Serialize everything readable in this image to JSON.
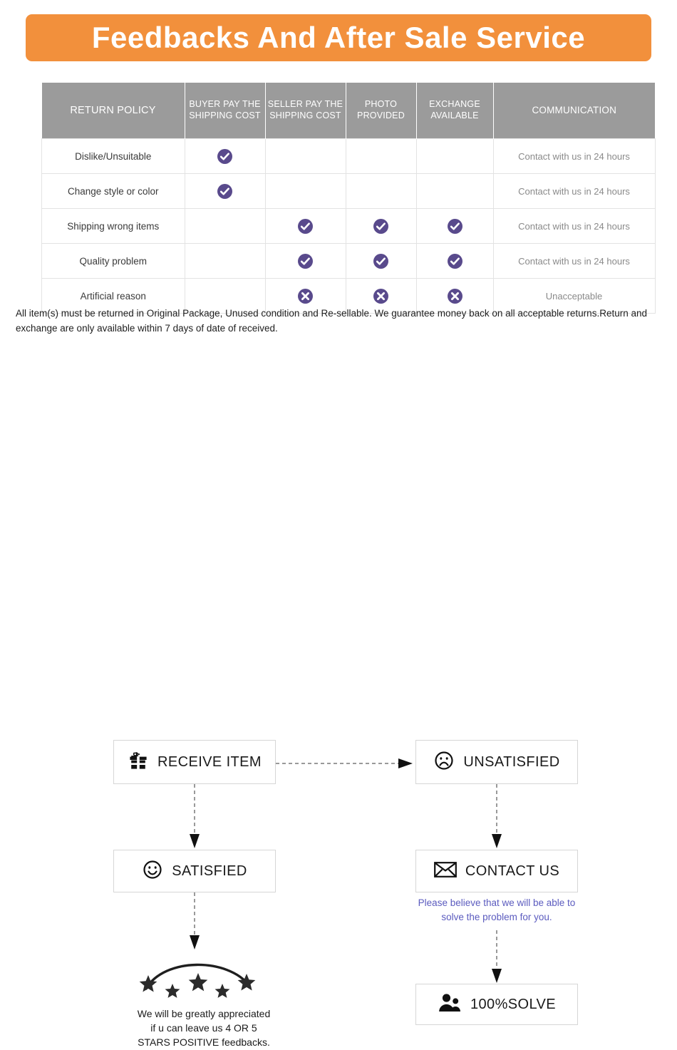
{
  "banner": {
    "title": "Feedbacks And After Sale Service",
    "background_color": "#f2903c",
    "text_color": "#ffffff"
  },
  "policy_table": {
    "header_background": "#9b9b9b",
    "accent_color": "#594a8c",
    "columns": [
      {
        "key": "policy",
        "label": "RETURN POLICY"
      },
      {
        "key": "buyer",
        "label": "BUYER PAY THE SHIPPING COST"
      },
      {
        "key": "seller",
        "label": "SELLER PAY THE SHIPPING COST"
      },
      {
        "key": "photo",
        "label": "PHOTO PROVIDED"
      },
      {
        "key": "exchange",
        "label": "EXCHANGE AVAILABLE"
      },
      {
        "key": "communication",
        "label": "COMMUNICATION"
      }
    ],
    "rows": [
      {
        "policy": "Dislike/Unsuitable",
        "buyer": "check",
        "seller": "",
        "photo": "",
        "exchange": "",
        "communication": "Contact with us in 24 hours"
      },
      {
        "policy": "Change style or color",
        "buyer": "check",
        "seller": "",
        "photo": "",
        "exchange": "",
        "communication": "Contact with us in 24 hours"
      },
      {
        "policy": "Shipping wrong items",
        "buyer": "",
        "seller": "check",
        "photo": "check",
        "exchange": "check",
        "communication": "Contact with us in 24 hours"
      },
      {
        "policy": "Quality problem",
        "buyer": "",
        "seller": "check",
        "photo": "check",
        "exchange": "check",
        "communication": "Contact with us in 24 hours"
      },
      {
        "policy": "Artificial reason",
        "buyer": "",
        "seller": "cross",
        "photo": "cross",
        "exchange": "cross",
        "communication": "Unacceptable"
      }
    ]
  },
  "disclaimer": "All item(s) must be returned in Original Package, Unused condition and Re-sellable. We guarantee money back on all acceptable returns.Return and exchange are only available within 7 days of date of received.",
  "flow": {
    "receive": {
      "label": "RECEIVE ITEM",
      "icon": "gift-icon"
    },
    "unsatisfied": {
      "label": "UNSATISFIED",
      "icon": "sad-face-icon"
    },
    "satisfied": {
      "label": "SATISFIED",
      "icon": "happy-face-icon"
    },
    "contact": {
      "label": "CONTACT US",
      "icon": "envelope-icon"
    },
    "solve": {
      "label": "100%SOLVE",
      "icon": "people-icon"
    },
    "contact_note": "Please believe that we will be able to solve the problem for you.",
    "contact_note_color": "#5b5bbf",
    "stars_note_line1": "We will be greatly appreciated",
    "stars_note_line2": "if u can leave us 4 OR 5",
    "stars_note_line3": "STARS POSITIVE feedbacks.",
    "star_count": 5
  }
}
